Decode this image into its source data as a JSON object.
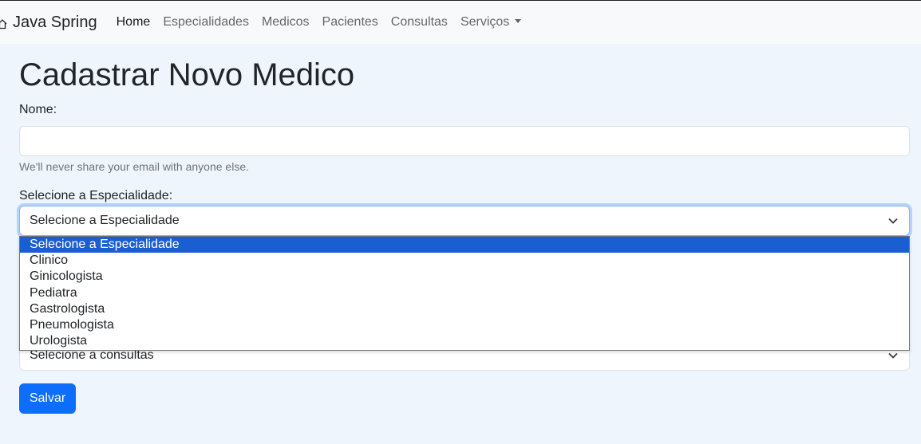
{
  "navbar": {
    "brand": "Java Spring",
    "links": [
      {
        "label": "Home"
      },
      {
        "label": "Especialidades"
      },
      {
        "label": "Medicos"
      },
      {
        "label": "Pacientes"
      },
      {
        "label": "Consultas"
      },
      {
        "label": "Serviços"
      }
    ]
  },
  "page": {
    "title": "Cadastrar Novo Medico"
  },
  "form": {
    "nome_label": "Nome:",
    "nome_value": "",
    "nome_help": "We'll never share your email with anyone else.",
    "especialidade_label": "Selecione a Especialidade:",
    "especialidade_selected": "Selecione a Especialidade",
    "especialidade_options": [
      "Selecione a Especialidade",
      "Clinico",
      "Ginicologista",
      "Pediatra",
      "Gastrologista",
      "Pneumologista",
      "Urologista"
    ],
    "consultas_selected": "Selecione a consultas",
    "submit_label": "Salvar"
  },
  "colors": {
    "primary": "#0d6efd",
    "option_highlight": "#1a5fd2",
    "page_background": "#eef5fd"
  }
}
